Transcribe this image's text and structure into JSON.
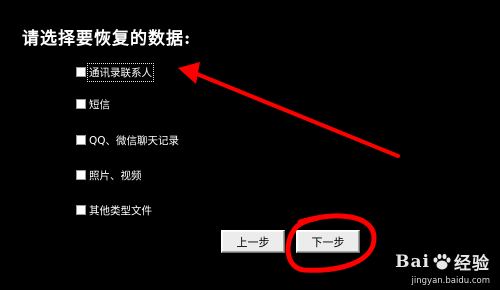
{
  "dialog": {
    "title": "请选择要恢复的数据:"
  },
  "options": [
    {
      "label": "通讯录联系人",
      "checked": false,
      "focused": true
    },
    {
      "label": "短信",
      "checked": false
    },
    {
      "label": "QQ、微信聊天记录",
      "checked": false
    },
    {
      "label": "照片、视频",
      "checked": false
    },
    {
      "label": "其他类型文件",
      "checked": false
    }
  ],
  "buttons": {
    "prev_label": "上一步",
    "next_label": "下一步"
  },
  "annotations": {
    "color": "#ff0000"
  },
  "watermark": {
    "brand_prefix": "Bai",
    "brand_suffix": "经验",
    "url": "jingyan.baidu.com"
  }
}
